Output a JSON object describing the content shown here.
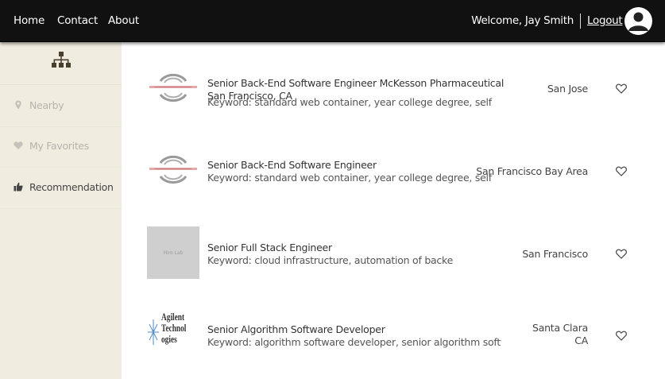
{
  "nav": {
    "home": "Home",
    "contact": "Contact",
    "about": "About",
    "welcome": "Welcome, Jay Smith",
    "logout": "Logout",
    "avatar_icon": "user-avatar-icon"
  },
  "sidebar": {
    "top_icon": "org-chart-icon",
    "items": [
      {
        "label": "Nearby",
        "icon": "location-pin-icon"
      },
      {
        "label": "My Favorites",
        "icon": "heart-icon"
      },
      {
        "label": "Recommendation",
        "icon": "thumbs-up-icon"
      }
    ]
  },
  "jobs": [
    {
      "title": "Senior Back-End Software Engineer McKesson Pharmaceutical San Francisco, CA",
      "keyword": "Keyword: standard web container, year college degree, self",
      "location": "San Jose"
    },
    {
      "title": "Senior Back-End Software Engineer",
      "keyword": "Keyword: standard web container, year college degree, self",
      "location": "San Francisco Bay Area"
    },
    {
      "title": "Senior Full Stack Engineer",
      "keyword": "Keyword: cloud infrastructure, automation of backend, li",
      "location": "San Francisco",
      "logo_text": "Hiro Lab"
    },
    {
      "title": "Senior Algorithm Software Developer",
      "keyword": "Keyword: algorithm software developer, senior algorithm software",
      "location": "Santa Clara\nCA",
      "logo_text": "Agilent Technologies"
    }
  ]
}
